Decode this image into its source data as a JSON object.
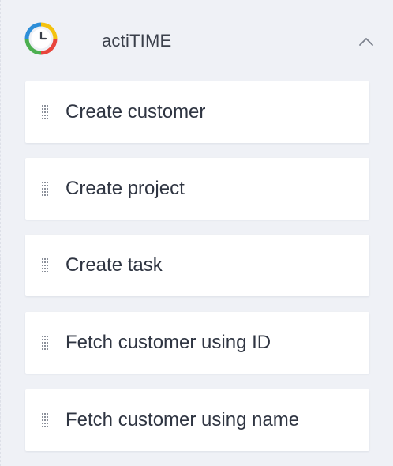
{
  "app": {
    "title": "actiTIME",
    "logo_icon": "actitime-clock-icon",
    "collapse_icon": "chevron-up-icon"
  },
  "actions": [
    {
      "label": "Create customer",
      "handle_icon": "drag-handle-icon"
    },
    {
      "label": "Create project",
      "handle_icon": "drag-handle-icon"
    },
    {
      "label": "Create task",
      "handle_icon": "drag-handle-icon"
    },
    {
      "label": "Fetch customer using ID",
      "handle_icon": "drag-handle-icon"
    },
    {
      "label": "Fetch customer using name",
      "handle_icon": "drag-handle-icon"
    }
  ],
  "colors": {
    "background": "#eff1f6",
    "card": "#ffffff",
    "text": "#2f3542",
    "logo_green": "#4caf50",
    "logo_yellow": "#f4c20d",
    "logo_red": "#e8453c",
    "logo_blue": "#2d8ed8"
  }
}
